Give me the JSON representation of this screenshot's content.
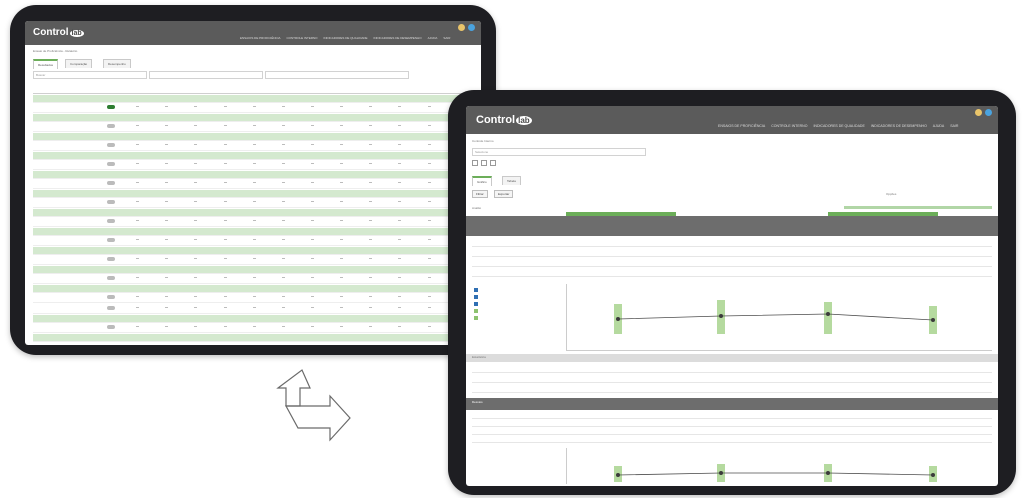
{
  "brand": {
    "logo_main": "Control",
    "logo_badge": "lab"
  },
  "menu_items": [
    "ENSAIOS DE PROFICIÊNCIA",
    "CONTROLE INTERNO",
    "INDICADORES DE QUALIDADE",
    "INDICADORES DE DESEMPENHO",
    "AJUDA",
    "SAIR"
  ],
  "left_screen": {
    "page_title": "Ensaio de Proficiência - Relatório",
    "tabs": [
      "Resultados",
      "Comparação",
      "Desempenho"
    ],
    "search_placeholder": "Buscar",
    "row_count": 18
  },
  "right_screen": {
    "page_title": "Controle Interno",
    "filter_placeholder": "Selecione",
    "tabs": [
      "Gráfico",
      "Tabela"
    ],
    "buttons": [
      "Filtrar",
      "Exportar"
    ],
    "options_label": "Opções",
    "section_label": "Analito",
    "table_sections": [
      "Estatística",
      "Desvios"
    ]
  },
  "colors": {
    "tablet_frame": "#1e1e22",
    "topbar": "#5b5b5b",
    "accent_green": "#6cae59",
    "light_green": "#d4e9cf",
    "table_header": "#6d6d6d"
  },
  "icons": [
    "flag-icon",
    "user-icon",
    "swap-arrows-icon"
  ]
}
